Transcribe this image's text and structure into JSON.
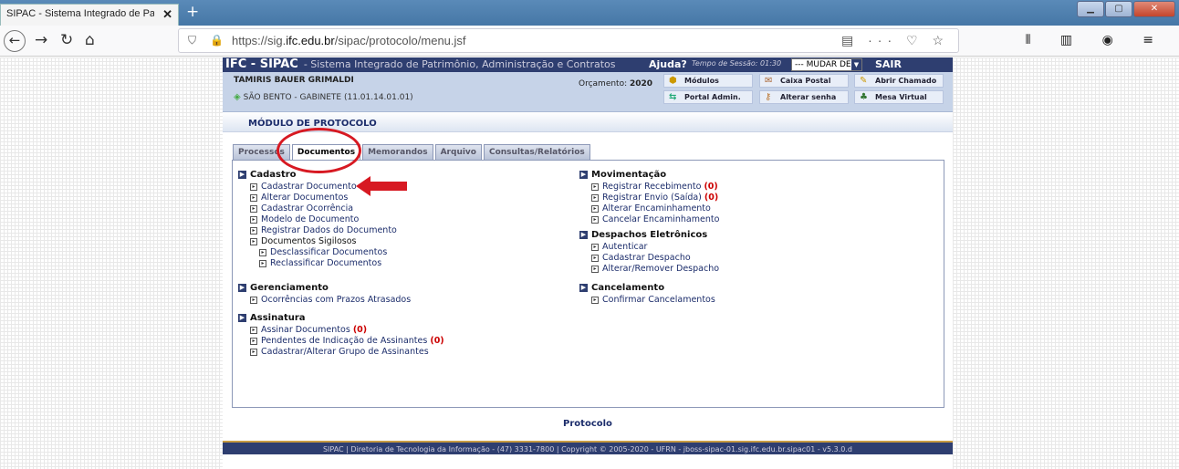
{
  "browser": {
    "tab_title": "SIPAC - Sistema Integrado de Patrim",
    "tab_close": "✕",
    "new_tab": "+",
    "url_prefix": "https://sig.",
    "url_domain": "ifc.edu.br",
    "url_path": "/sipac/protocolo/menu.jsf",
    "url_icons": "▤ ··· ♡ ☆",
    "toolbar_icons": "⫴ ▥ ◉ ≡",
    "win_min": "▁",
    "win_max": "▢",
    "win_close": "✕",
    "nav_back": "←",
    "nav_forward": "→",
    "nav_reload": "↻",
    "nav_home": "⌂",
    "shield": "⛉",
    "lock": "🔒"
  },
  "header": {
    "system": "IFC - SIPAC",
    "system_desc": "- Sistema Integrado de Patrimônio, Administração e Contratos",
    "help": "Ajuda?",
    "session": "Tempo de Sessão: 01:30",
    "system_select": "--- MUDAR DE SISTEMA ---",
    "logout": "SAIR"
  },
  "user": {
    "name": "TAMIRIS BAUER GRIMALDI",
    "unit": "SÃO BENTO - GABINETE (11.01.14.01.01)",
    "budget_label": "Orçamento:",
    "budget_year": "2020"
  },
  "shortcuts": {
    "modules": "Módulos",
    "mailbox": "Caixa Postal",
    "ticket": "Abrir Chamado",
    "admin": "Portal Admin.",
    "password": "Alterar senha",
    "desk": "Mesa Virtual"
  },
  "module_title": "MÓDULO DE PROTOCOLO",
  "tabs": [
    "Processos",
    "Documentos",
    "Memorandos",
    "Arquivo",
    "Consultas/Relatórios"
  ],
  "menu": {
    "cadastro": {
      "title": "Cadastro",
      "items": [
        "Cadastrar Documento",
        "Alterar Documentos",
        "Cadastrar Ocorrência",
        "Modelo de Documento",
        "Registrar Dados do Documento"
      ],
      "sigilosos": "Documentos Sigilosos",
      "sigilosos_items": [
        "Desclassificar Documentos",
        "Reclassificar Documentos"
      ]
    },
    "gerenciamento": {
      "title": "Gerenciamento",
      "items": [
        "Ocorrências com Prazos Atrasados"
      ]
    },
    "assinatura": {
      "title": "Assinatura",
      "items": [
        "Assinar Documentos",
        "Pendentes de Indicação de Assinantes",
        "Cadastrar/Alterar Grupo de Assinantes"
      ],
      "counts": [
        "(0)",
        "(0)"
      ]
    },
    "movimentacao": {
      "title": "Movimentação",
      "items": [
        "Registrar Recebimento",
        "Registrar Envio (Saída)",
        "Alterar Encaminhamento",
        "Cancelar Encaminhamento"
      ],
      "counts": [
        "(0)",
        "(0)"
      ]
    },
    "despachos": {
      "title": "Despachos Eletrônicos",
      "items": [
        "Autenticar",
        "Cadastrar Despacho",
        "Alterar/Remover Despacho"
      ]
    },
    "cancelamento": {
      "title": "Cancelamento",
      "items": [
        "Confirmar Cancelamentos"
      ]
    }
  },
  "footer": {
    "link": "Protocolo",
    "text": "SIPAC | Diretoria de Tecnologia da Informação - (47) 3331-7800 | Copyright © 2005-2020 - UFRN - jboss-sipac-01.sig.ifc.edu.br.sipac01 - v5.3.0.d"
  },
  "annotation_color": "#d71922"
}
